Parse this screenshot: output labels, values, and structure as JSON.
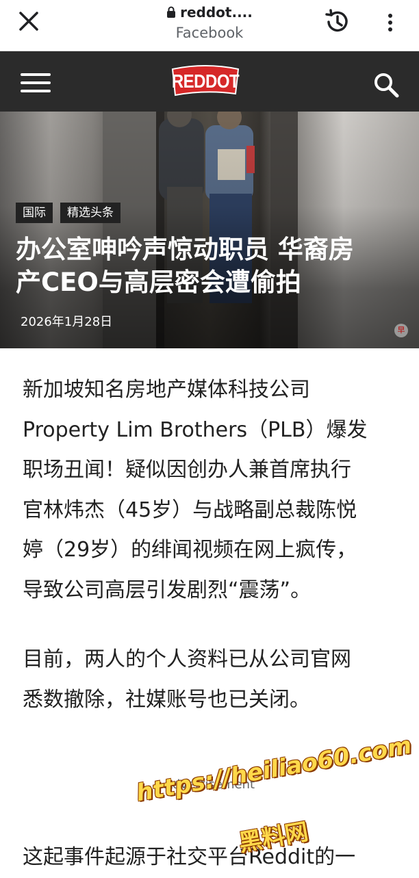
{
  "browser": {
    "url": "reddot....",
    "site_name": "Facebook"
  },
  "site": {
    "logo_text": "REDDOT",
    "brand_color": "#d62828"
  },
  "hero": {
    "tags": [
      "国际",
      "精选头条"
    ],
    "headline_line1": "办公室呻吟声惊动职员 华裔房",
    "headline_line2": "产CEO与高层密会遭偷拍",
    "date": "2026年1月28日",
    "watermark": "早"
  },
  "article": {
    "p1_lines": [
      "新加坡知名房地产媒体科技公司",
      "Property Lim Brothers（PLB）爆发",
      "职场丑闻！疑似因创办人兼首席执行",
      "官林炜杰（45岁）与战略副总裁陈悦",
      "婷（29岁）的绯闻视频在网上疯传，",
      "导致公司高层引发剧烈“震荡”。"
    ],
    "p2_lines": [
      "目前，两人的个人资料已从公司官网",
      "悉数撤除，社媒账号也已关闭。"
    ],
    "ad_label": "Advertisement",
    "p3_line": "这起事件起源于社交平台Reddit的一"
  },
  "overlay": {
    "line1": "https://heiliao60.com",
    "line2": "黑料网"
  }
}
